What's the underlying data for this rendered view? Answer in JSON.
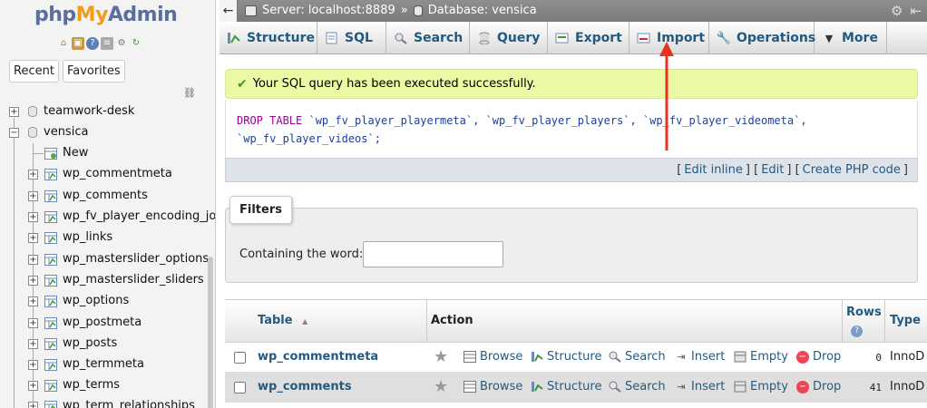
{
  "nav": {
    "logo": {
      "php": "php",
      "my": "My",
      "admin": "Admin"
    },
    "icons": [
      "home-icon",
      "exit-icon",
      "help-icon",
      "docs-icon",
      "settings-icon",
      "reload-icon"
    ],
    "tabs": {
      "recent": "Recent",
      "favorites": "Favorites"
    },
    "tree": [
      {
        "label": "teamwork-desk",
        "type": "db",
        "expanded": false
      },
      {
        "label": "vensica",
        "type": "db",
        "expanded": true
      },
      {
        "label": "New",
        "type": "new"
      },
      {
        "label": "wp_commentmeta",
        "type": "table"
      },
      {
        "label": "wp_comments",
        "type": "table"
      },
      {
        "label": "wp_fv_player_encoding_jo",
        "type": "table"
      },
      {
        "label": "wp_links",
        "type": "table"
      },
      {
        "label": "wp_masterslider_options",
        "type": "table"
      },
      {
        "label": "wp_masterslider_sliders",
        "type": "table"
      },
      {
        "label": "wp_options",
        "type": "table"
      },
      {
        "label": "wp_postmeta",
        "type": "table"
      },
      {
        "label": "wp_posts",
        "type": "table"
      },
      {
        "label": "wp_termmeta",
        "type": "table"
      },
      {
        "label": "wp_terms",
        "type": "table"
      },
      {
        "label": "wp_term_relationships",
        "type": "table"
      }
    ]
  },
  "topbar": {
    "server": "Server: localhost:8889",
    "separator": "»",
    "database": "Database: vensica"
  },
  "tabs": [
    {
      "label": "Structure",
      "icon": "structure-icon"
    },
    {
      "label": "SQL",
      "icon": "sql-icon"
    },
    {
      "label": "Search",
      "icon": "search-icon"
    },
    {
      "label": "Query",
      "icon": "query-icon"
    },
    {
      "label": "Export",
      "icon": "export-icon"
    },
    {
      "label": "Import",
      "icon": "import-icon"
    },
    {
      "label": "Operations",
      "icon": "wrench-icon"
    },
    {
      "label": "More",
      "icon": "caret-down-icon"
    }
  ],
  "message": {
    "success": "Your SQL query has been executed successfully.",
    "sql_kw": "DROP TABLE",
    "sql_line1_ids": "`wp_fv_player_playermeta`, `wp_fv_player_players`, `wp_fv_player_videometa`,",
    "sql_line2": "`wp_fv_player_videos`;",
    "links": {
      "open1": "[",
      "edit_inline": "Edit inline",
      "sep1": "] [",
      "edit": "Edit",
      "sep2": "] [",
      "create_php": "Create PHP code",
      "close": "]"
    }
  },
  "filters": {
    "legend": "Filters",
    "label": "Containing the word:",
    "value": ""
  },
  "table": {
    "headers": {
      "table": "Table",
      "sort": "▲",
      "action": "Action",
      "rows": "Rows",
      "type": "Type"
    },
    "action_labels": {
      "browse": "Browse",
      "structure": "Structure",
      "search": "Search",
      "insert": "Insert",
      "empty": "Empty",
      "drop": "Drop"
    },
    "rows": [
      {
        "name": "wp_commentmeta",
        "rows": "0",
        "engine": "InnoD"
      },
      {
        "name": "wp_comments",
        "rows": "41",
        "engine": "InnoD"
      }
    ]
  },
  "colors": {
    "link": "#235a81",
    "success_bg": "#ebf8a4",
    "annotation": "#e8321e"
  }
}
